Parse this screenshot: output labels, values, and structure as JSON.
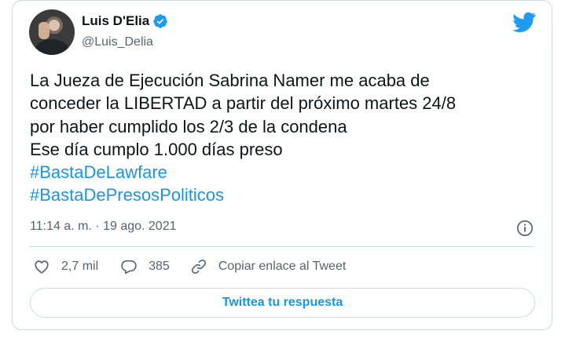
{
  "author": {
    "name": "Luis D'Elia",
    "handle": "@Luis_Delia",
    "verified": true
  },
  "tweet": {
    "text": "La Jueza de Ejecución Sabrina Namer me acaba de\nconceder la LIBERTAD a partir del próximo martes 24/8\npor haber cumplido los 2/3 de la condena\nEse día cumplo 1.000 días preso",
    "hashtags": [
      "#BastaDeLawfare",
      "#BastaDePresosPoliticos"
    ],
    "timestamp": "11:14 a. m. · 19 ago. 2021"
  },
  "actions": {
    "likes": "2,7 mil",
    "replies": "385",
    "copy_link": "Copiar enlace al Tweet"
  },
  "reply_button": "Twittea tu respuesta",
  "colors": {
    "accent": "#1b95e0",
    "verified": "#1d9bf0",
    "text": "#0f1419",
    "secondary": "#536471",
    "border": "#cfd9de"
  },
  "icons": [
    "avatar",
    "verified-badge-icon",
    "twitter-bird-icon",
    "info-icon",
    "heart-icon",
    "reply-bubble-icon",
    "link-icon"
  ]
}
